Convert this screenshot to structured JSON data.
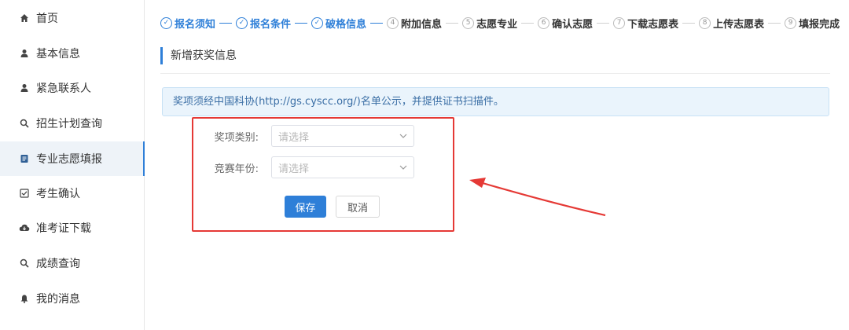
{
  "sidebar": {
    "items": [
      {
        "label": "首页",
        "icon": "home-icon"
      },
      {
        "label": "基本信息",
        "icon": "user-icon"
      },
      {
        "label": "紧急联系人",
        "icon": "user-icon"
      },
      {
        "label": "招生计划查询",
        "icon": "search-icon"
      },
      {
        "label": "专业志愿填报",
        "icon": "document-icon",
        "active": true
      },
      {
        "label": "考生确认",
        "icon": "checkbox-icon"
      },
      {
        "label": "准考证下载",
        "icon": "cloud-download-icon"
      },
      {
        "label": "成绩查询",
        "icon": "search-icon"
      },
      {
        "label": "我的消息",
        "icon": "bell-icon"
      }
    ]
  },
  "steps": [
    {
      "num": "✓",
      "label": "报名须知",
      "status": "done"
    },
    {
      "num": "✓",
      "label": "报名条件",
      "status": "done"
    },
    {
      "num": "✓",
      "label": "破格信息",
      "status": "done"
    },
    {
      "num": "4",
      "label": "附加信息",
      "status": "todo"
    },
    {
      "num": "5",
      "label": "志愿专业",
      "status": "todo"
    },
    {
      "num": "6",
      "label": "确认志愿",
      "status": "todo"
    },
    {
      "num": "7",
      "label": "下载志愿表",
      "status": "todo"
    },
    {
      "num": "8",
      "label": "上传志愿表",
      "status": "todo"
    },
    {
      "num": "9",
      "label": "填报完成",
      "status": "todo"
    }
  ],
  "section": {
    "title": "新增获奖信息"
  },
  "notice": {
    "text": "奖项须经中国科协(http://gs.cyscc.org/)名单公示，并提供证书扫描件。"
  },
  "form": {
    "award_type_label": "奖项类别:",
    "award_type_placeholder": "请选择",
    "competition_year_label": "竞赛年份:",
    "competition_year_placeholder": "请选择"
  },
  "buttons": {
    "save": "保存",
    "cancel": "取消"
  },
  "colors": {
    "accent": "#2e7fd8",
    "annotation": "#e53935",
    "notice_bg": "#eaf4fc"
  }
}
